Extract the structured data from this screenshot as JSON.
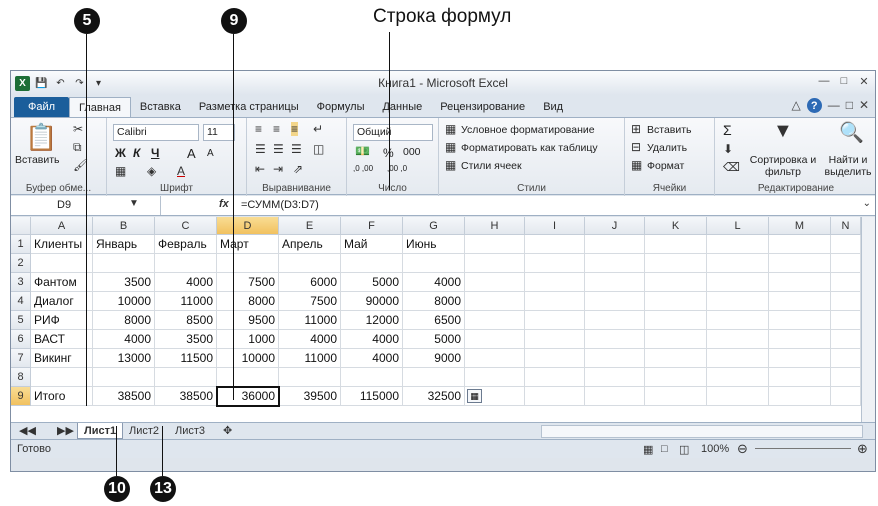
{
  "annotations": {
    "formula_bar_caption": "Строка формул",
    "callouts": [
      "5",
      "9",
      "10",
      "13"
    ]
  },
  "window": {
    "title": "Книга1 - Microsoft Excel",
    "controls": [
      "minimize-icon",
      "restore-icon",
      "close-icon"
    ]
  },
  "ribbon_tabs": [
    "Файл",
    "Главная",
    "Вставка",
    "Разметка страницы",
    "Формулы",
    "Данные",
    "Рецензирование",
    "Вид"
  ],
  "ribbon": {
    "clipboard": {
      "paste": "Вставить",
      "label": "Буфер обме..."
    },
    "font": {
      "name": "Calibri",
      "size": "11",
      "bold": "Ж",
      "italic": "К",
      "underline": "Ч",
      "grow": "A",
      "shrink": "A",
      "label": "Шрифт"
    },
    "alignment": {
      "label": "Выравнивание"
    },
    "number": {
      "format": "Общий",
      "percent": "%",
      "thousands": "000",
      "dec_up": ",0 ,00",
      "dec_down": ",00 ,0",
      "label": "Число"
    },
    "styles": {
      "conditional": "Условное форматирование",
      "as_table": "Форматировать как таблицу",
      "cell_styles": "Стили ячеек",
      "label": "Стили"
    },
    "cells": {
      "insert": "Вставить",
      "delete": "Удалить",
      "format": "Формат",
      "label": "Ячейки"
    },
    "editing": {
      "sum": "Σ",
      "sort": "Сортировка и фильтр",
      "find": "Найти и выделить",
      "label": "Редактирование"
    }
  },
  "formula_bar": {
    "name_box": "D9",
    "fx": "fx",
    "formula": "=СУММ(D3:D7)"
  },
  "columns": [
    "A",
    "B",
    "C",
    "D",
    "E",
    "F",
    "G",
    "H",
    "I",
    "J",
    "K",
    "L",
    "M",
    "N"
  ],
  "rows": [
    [
      "1",
      "Клиенты",
      "Январь",
      "Февраль",
      "Март",
      "Апрель",
      "Май",
      "Июнь"
    ],
    [
      "2",
      "",
      "",
      "",
      "",
      "",
      "",
      ""
    ],
    [
      "3",
      "Фантом",
      "3500",
      "4000",
      "7500",
      "6000",
      "5000",
      "4000"
    ],
    [
      "4",
      "Диалог",
      "10000",
      "11000",
      "8000",
      "7500",
      "90000",
      "8000"
    ],
    [
      "5",
      "РИФ",
      "8000",
      "8500",
      "9500",
      "11000",
      "12000",
      "6500"
    ],
    [
      "6",
      "ВАСТ",
      "4000",
      "3500",
      "1000",
      "4000",
      "4000",
      "5000"
    ],
    [
      "7",
      "Викинг",
      "13000",
      "11500",
      "10000",
      "11000",
      "4000",
      "9000"
    ],
    [
      "8",
      "",
      "",
      "",
      "",
      "",
      "",
      ""
    ],
    [
      "9",
      "Итого",
      "38500",
      "38500",
      "36000",
      "39500",
      "115000",
      "32500"
    ]
  ],
  "sheets": [
    "Лист1",
    "Лист2",
    "Лист3"
  ],
  "status": {
    "ready": "Готово",
    "zoom": "100%"
  }
}
